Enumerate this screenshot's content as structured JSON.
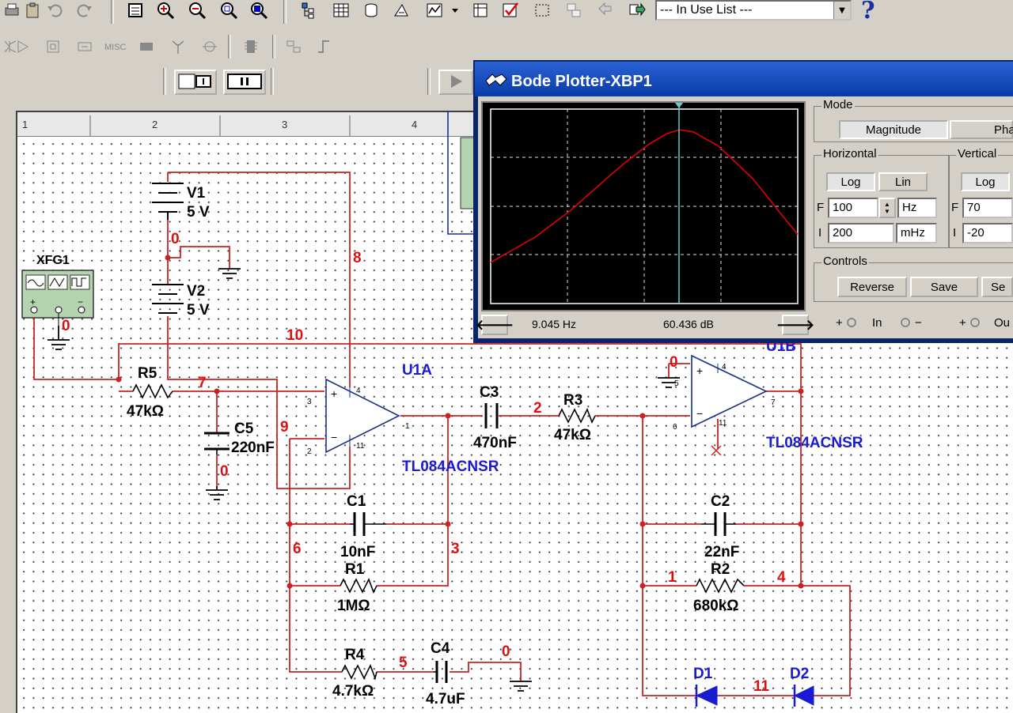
{
  "toolbar": {
    "in_use_list": "--- In Use List ---",
    "help": "?",
    "misc_label": "MISC"
  },
  "ruler": {
    "marks": [
      "1",
      "2",
      "3",
      "4"
    ]
  },
  "bode": {
    "title": "Bode Plotter-XBP1",
    "mode_label": "Mode",
    "mode_magnitude": "Magnitude",
    "mode_phase": "Phas",
    "horizontal_label": "Horizontal",
    "vertical_label": "Vertical",
    "log_label": "Log",
    "lin_label": "Lin",
    "h_f_label": "F",
    "h_f_value": "100",
    "h_f_unit": "Hz",
    "h_i_label": "I",
    "h_i_value": "200",
    "h_i_unit": "mHz",
    "v_f_label": "F",
    "v_f_value": "70",
    "v_i_label": "I",
    "v_i_value": "-20",
    "controls_label": "Controls",
    "reverse_label": "Reverse",
    "save_label": "Save",
    "set_label": "Se",
    "status_freq": "9.045 Hz",
    "status_gain": "60.436 dB",
    "in_label": "In",
    "minus": "−",
    "plus": "+",
    "out_label": "Ou"
  },
  "chart_data": {
    "type": "line",
    "title": "",
    "xlabel": "",
    "ylabel": "",
    "x_scale": "log",
    "xlim": [
      0.2,
      100
    ],
    "ylim": [
      -20,
      70
    ],
    "cursor": {
      "x": 9.045,
      "y": 60.436
    },
    "series": [
      {
        "color": "#e00000",
        "x": [
          0.2,
          0.5,
          1,
          2,
          3,
          5,
          7,
          9.045,
          12,
          20,
          40,
          70,
          100
        ],
        "y": [
          -1,
          11,
          23,
          37,
          45,
          54,
          58.5,
          60.4,
          59.5,
          53,
          38,
          22,
          12
        ]
      }
    ]
  },
  "circuit": {
    "components": [
      {
        "ref": "V1",
        "value": "5 V"
      },
      {
        "ref": "V2",
        "value": "5 V"
      },
      {
        "ref": "XFG1"
      },
      {
        "ref": "R5",
        "value": "47kΩ"
      },
      {
        "ref": "C5",
        "value": "220nF"
      },
      {
        "ref": "U1A",
        "value": "TL084ACNSR"
      },
      {
        "ref": "C3",
        "value": "470nF"
      },
      {
        "ref": "R3",
        "value": "47kΩ"
      },
      {
        "ref": "U1B",
        "value": "TL084ACNSR"
      },
      {
        "ref": "C1",
        "value": "10nF"
      },
      {
        "ref": "R1",
        "value": "1MΩ"
      },
      {
        "ref": "C2",
        "value": "22nF"
      },
      {
        "ref": "R2",
        "value": "680kΩ"
      },
      {
        "ref": "R4",
        "value": "4.7kΩ"
      },
      {
        "ref": "C4",
        "value": "4.7uF"
      },
      {
        "ref": "D1"
      },
      {
        "ref": "D2"
      }
    ],
    "u1b_label": "U1B",
    "nets": [
      "0",
      "0",
      "0",
      "0",
      "0",
      "1",
      "2",
      "3",
      "4",
      "5",
      "6",
      "7",
      "8",
      "9",
      "10",
      "11"
    ],
    "pins": [
      "3",
      "2",
      "1",
      "4",
      "11",
      "5",
      "6",
      "7",
      "4",
      "11"
    ]
  },
  "colors": {
    "wire": "#cc2222",
    "net_label": "#dd1111",
    "part_label": "#1a1ad0",
    "trace": "#e00000",
    "cursor": "#66cccc"
  }
}
